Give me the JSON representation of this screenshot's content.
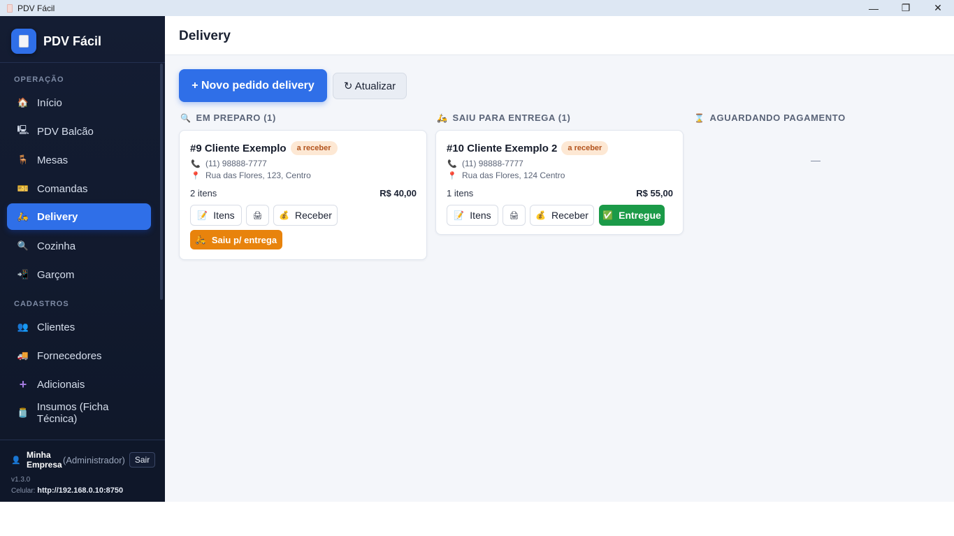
{
  "window": {
    "title": "PDV Fácil",
    "controls": [
      "—",
      "❐",
      "✕"
    ]
  },
  "sidebar": {
    "brand": "PDV Fácil",
    "sections": [
      {
        "label": "OPERAÇÃO"
      },
      {
        "label": "CADASTROS"
      }
    ],
    "items": [
      {
        "label": "Início",
        "icon": "home-icon"
      },
      {
        "label": "PDV Balcão",
        "icon": "cash-register-icon"
      },
      {
        "label": "Mesas",
        "icon": "table-icon"
      },
      {
        "label": "Comandas",
        "icon": "ticket-icon"
      },
      {
        "label": "Delivery",
        "icon": "scooter-icon",
        "active": true
      },
      {
        "label": "Cozinha",
        "icon": "magnifier-icon"
      },
      {
        "label": "Garçom",
        "icon": "waiter-icon"
      },
      {
        "label": "Clientes",
        "icon": "users-icon"
      },
      {
        "label": "Fornecedores",
        "icon": "truck-icon"
      },
      {
        "label": "Adicionais",
        "icon": "plus-icon"
      },
      {
        "label": "Insumos (Ficha Técnica)",
        "icon": "jar-icon"
      }
    ],
    "footer": {
      "user_name": "Minha Empresa",
      "user_role": "(Administrador)",
      "logout": "Sair",
      "version": "v1.3.0",
      "mobile_label": "Celular:",
      "mobile_url": "http://192.168.0.10:8750"
    }
  },
  "main": {
    "title": "Delivery",
    "new_order_button": "+ Novo pedido delivery",
    "refresh_button": "↻ Atualizar",
    "columns": [
      {
        "title": "EM PREPARO (1)",
        "icon": "magnifier-icon"
      },
      {
        "title": "SAIU PARA ENTREGA (1)",
        "icon": "scooter-icon"
      },
      {
        "title": "AGUARDANDO PAGAMENTO",
        "icon": "hourglass-icon",
        "empty": "—"
      }
    ],
    "orders": [
      {
        "title": "#9 Cliente Exemplo",
        "badge": "a receber",
        "phone": "(11) 98888-7777",
        "address": "Rua das Flores, 123, Centro",
        "items": "2 itens",
        "total": "R$ 40,00",
        "btn_items": "Itens",
        "btn_receive": "Receber",
        "btn_dispatch": "Saiu p/ entrega"
      },
      {
        "title": "#10 Cliente Exemplo 2",
        "badge": "a receber",
        "phone": "(11) 98888-7777",
        "address": "Rua das Flores, 124 Centro",
        "items": "1 itens",
        "total": "R$ 55,00",
        "btn_items": "Itens",
        "btn_receive": "Receber",
        "btn_delivered": "Entregue"
      }
    ]
  },
  "colors": {
    "accent": "#2f6fe8",
    "sidebar": "#141d33",
    "success": "#1b9a48",
    "warning": "#e8830c",
    "badge_bg": "#fde8d4",
    "badge_text": "#b3541e"
  }
}
